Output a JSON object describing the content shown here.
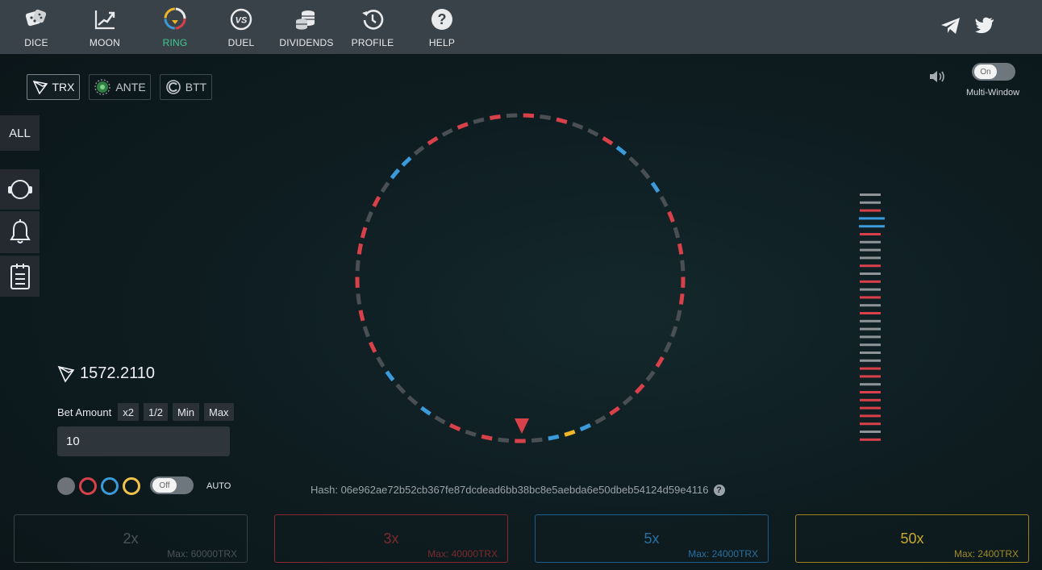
{
  "nav": {
    "items": [
      {
        "label": "DICE",
        "icon": "dice-icon"
      },
      {
        "label": "MOON",
        "icon": "moon-chart-icon"
      },
      {
        "label": "RING",
        "icon": "ring-icon",
        "active": true
      },
      {
        "label": "DUEL",
        "icon": "vs-icon"
      },
      {
        "label": "DIVIDENDS",
        "icon": "coins-icon"
      },
      {
        "label": "PROFILE",
        "icon": "history-clock-icon"
      },
      {
        "label": "HELP",
        "icon": "question-icon"
      }
    ],
    "social": [
      "telegram-icon",
      "twitter-icon"
    ]
  },
  "currencies": [
    {
      "label": "TRX",
      "active": true
    },
    {
      "label": "ANTE",
      "active": false
    },
    {
      "label": "BTT",
      "active": false
    }
  ],
  "sound_toggle": {
    "label": "On"
  },
  "multi_window_label": "Multi-Window",
  "sidebar": {
    "all_label": "ALL",
    "icons": [
      "headset-icon",
      "bell-icon",
      "clipboard-icon"
    ]
  },
  "balance": "1572.2110",
  "bet": {
    "label": "Bet Amount",
    "chips": [
      "x2",
      "1/2",
      "Min",
      "Max"
    ],
    "value": "10"
  },
  "auto": {
    "toggle_label": "Off",
    "label": "AUTO"
  },
  "hash": "Hash: 06e962ae72b52cb367fe87dcdead6bb38bc8e5aebda6e50dbeb54124d59e4116",
  "multipliers": [
    {
      "value": "2x",
      "max": "Max: 60000TRX",
      "color": "#3b4347",
      "text": "#4a5357"
    },
    {
      "value": "3x",
      "max": "Max: 40000TRX",
      "color": "#8a2a2e",
      "text": "#7b2a2e"
    },
    {
      "value": "5x",
      "max": "Max: 24000TRX",
      "color": "#1d5d87",
      "text": "#2a6f9f"
    },
    {
      "value": "50x",
      "max": "Max: 2400TRX",
      "color": "#9b8420",
      "text": "#a08a28"
    }
  ],
  "colors": {
    "gray": "#4a4f53",
    "red": "#d9414a",
    "blue": "#3b9ad9",
    "gold": "#f0b529",
    "accent_green": "#3dc98f"
  },
  "ring_segments": [
    "r",
    "g",
    "r",
    "g",
    "r",
    "g",
    "b",
    "g",
    "g",
    "b",
    "g",
    "r",
    "g",
    "r",
    "g",
    "r",
    "g",
    "r",
    "r",
    "g",
    "r",
    "g",
    "b",
    "b",
    "g",
    "r",
    "g",
    "r",
    "g",
    "r",
    "g",
    "r",
    "g",
    "r",
    "g",
    "g",
    "r",
    "b",
    "g",
    "g",
    "b",
    "g",
    "r",
    "g",
    "r",
    "g",
    "r",
    "r",
    "g",
    "g",
    "g",
    "r",
    "g",
    "r",
    "g",
    "r",
    "g",
    "b",
    "y",
    "b",
    "g"
  ],
  "history": [
    "g",
    "g",
    "r",
    "b",
    "b",
    "r",
    "g",
    "g",
    "g",
    "r",
    "g",
    "r",
    "g",
    "r",
    "g",
    "r",
    "g",
    "g",
    "g",
    "g",
    "g",
    "g",
    "r",
    "r",
    "g",
    "r",
    "r",
    "r",
    "r",
    "r",
    "g",
    "r"
  ]
}
